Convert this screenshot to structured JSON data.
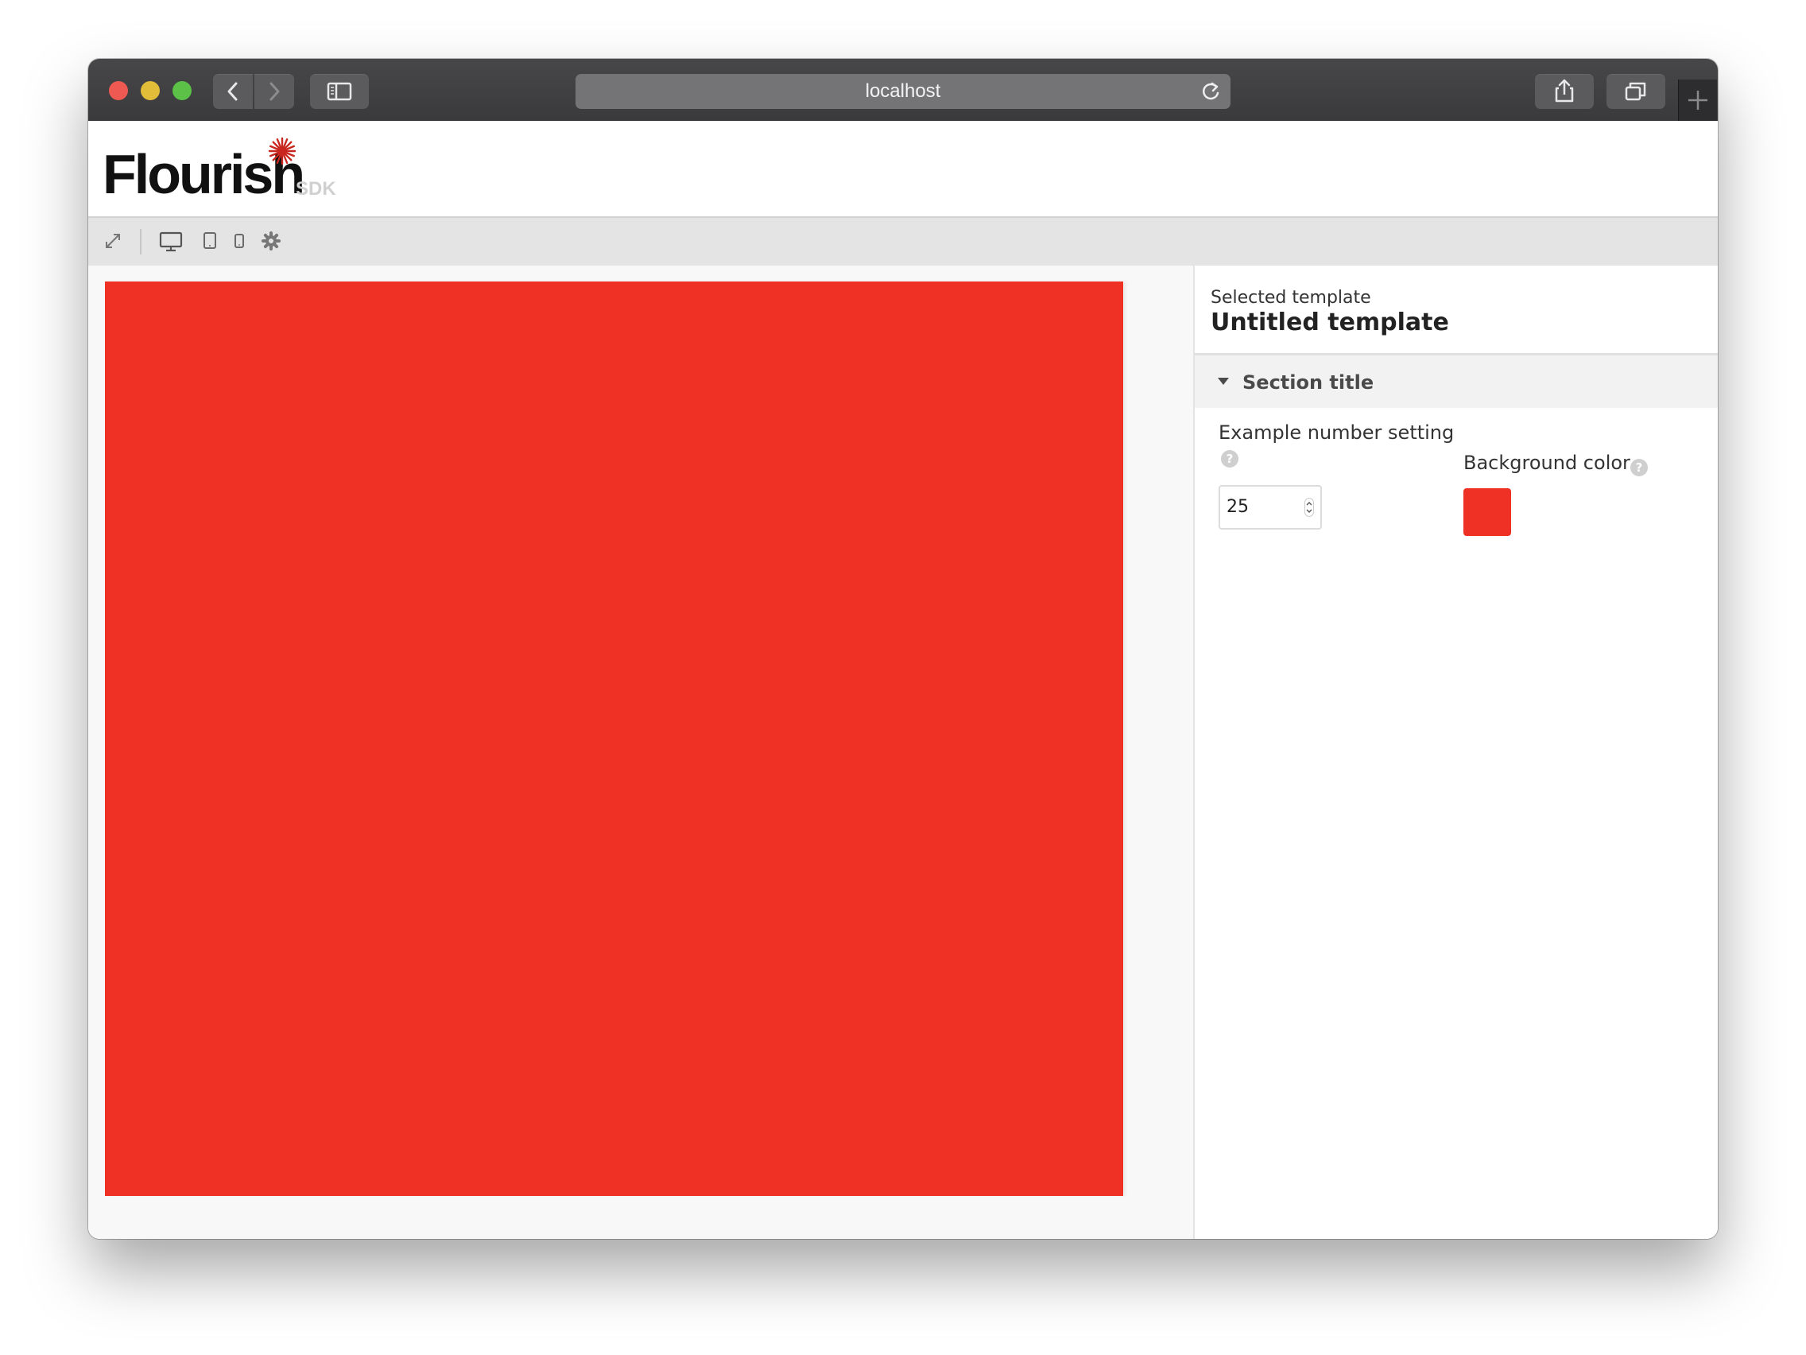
{
  "browser": {
    "address": "localhost"
  },
  "header": {
    "logo_text": "Flourish",
    "logo_badge": "SDK"
  },
  "toolbar": {
    "icons": [
      "expand-icon",
      "desktop-icon",
      "tablet-icon",
      "mobile-icon",
      "gear-icon"
    ]
  },
  "preview": {
    "background_color": "#ee3124"
  },
  "panel": {
    "selected_label": "Selected template",
    "selected_name": "Untitled template",
    "section_title": "Section title",
    "number_setting": {
      "label": "Example number setting",
      "value": "25"
    },
    "color_setting": {
      "label": "Background color",
      "value": "#ee3124"
    }
  }
}
